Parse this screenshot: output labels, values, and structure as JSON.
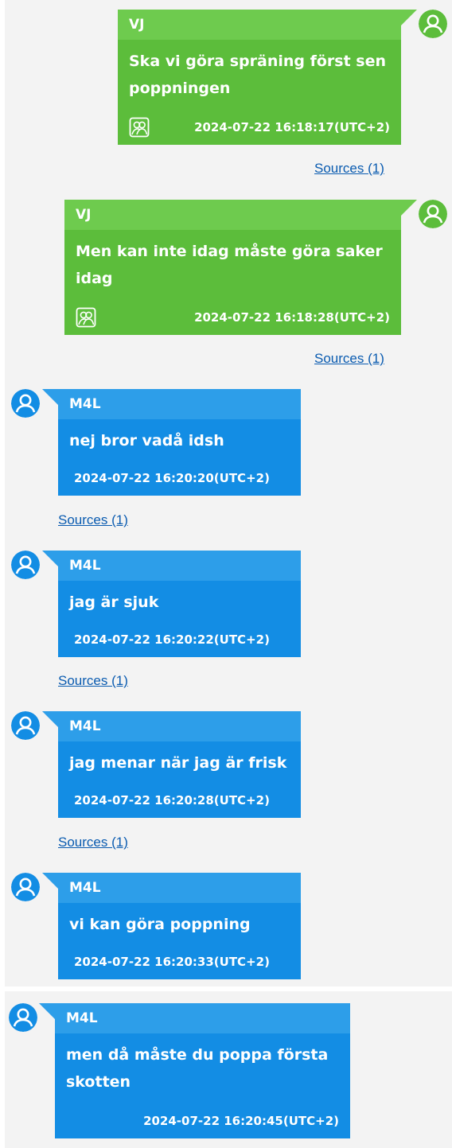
{
  "colors": {
    "outgoing_bubble": "#5cbd3b",
    "incoming_bubble": "#138de4",
    "link": "#0a5bb0",
    "panel": "#f3f3f3"
  },
  "messages": [
    {
      "sender": "VJ",
      "text": "Ska vi göra spräning först sen poppningen",
      "timestamp": "2024-07-22 16:18:17(UTC+2)",
      "sources": "Sources (1)",
      "direction": "outgoing",
      "icon": "group-icon"
    },
    {
      "sender": "VJ",
      "text": "Men kan inte idag måste göra saker idag",
      "timestamp": "2024-07-22 16:18:28(UTC+2)",
      "sources": "Sources (1)",
      "direction": "outgoing",
      "icon": "group-icon"
    },
    {
      "sender": "M4L",
      "text": "nej bror vadå idsh",
      "timestamp": "2024-07-22 16:20:20(UTC+2)",
      "sources": "Sources (1)",
      "direction": "incoming"
    },
    {
      "sender": "M4L",
      "text": "jag är sjuk",
      "timestamp": "2024-07-22 16:20:22(UTC+2)",
      "sources": "Sources (1)",
      "direction": "incoming"
    },
    {
      "sender": "M4L",
      "text": "jag menar när jag är frisk",
      "timestamp": "2024-07-22 16:20:28(UTC+2)",
      "sources": "Sources (1)",
      "direction": "incoming"
    },
    {
      "sender": "M4L",
      "text": "vi kan göra poppning",
      "timestamp": "2024-07-22 16:20:33(UTC+2)",
      "direction": "incoming"
    },
    {
      "sender": "M4L",
      "text": "men då måste du poppa första\nskotten",
      "timestamp": "2024-07-22 16:20:45(UTC+2)",
      "direction": "incoming"
    }
  ]
}
